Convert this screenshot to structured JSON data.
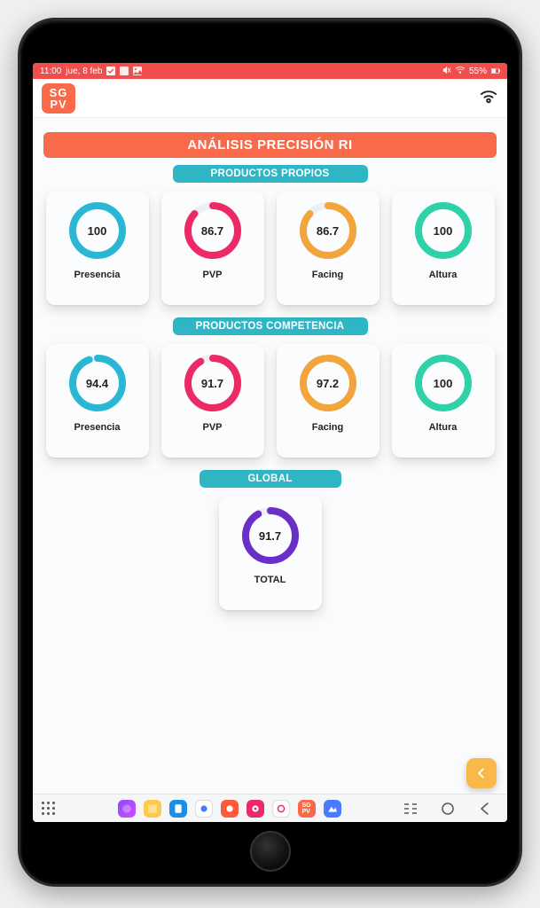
{
  "statusBar": {
    "time": "11:00",
    "date": "jue, 8 feb",
    "battery": "55%"
  },
  "header": {
    "logo_line1": "SG",
    "logo_line2": "PV"
  },
  "title": "ANÁLISIS PRECISIÓN RI",
  "sections": {
    "propios": {
      "label": "PRODUCTOS PROPIOS",
      "cards": [
        {
          "value": "100",
          "pct": 100,
          "label": "Presencia",
          "color": "#29b7d3"
        },
        {
          "value": "86.7",
          "pct": 86.7,
          "label": "PVP",
          "color": "#ec2a66"
        },
        {
          "value": "86.7",
          "pct": 86.7,
          "label": "Facing",
          "color": "#f2a53c"
        },
        {
          "value": "100",
          "pct": 100,
          "label": "Altura",
          "color": "#2fd1a8"
        }
      ]
    },
    "competencia": {
      "label": "PRODUCTOS COMPETENCIA",
      "cards": [
        {
          "value": "94.4",
          "pct": 94.4,
          "label": "Presencia",
          "color": "#29b7d3"
        },
        {
          "value": "91.7",
          "pct": 91.7,
          "label": "PVP",
          "color": "#ec2a66"
        },
        {
          "value": "97.2",
          "pct": 97.2,
          "label": "Facing",
          "color": "#f2a53c"
        },
        {
          "value": "100",
          "pct": 100,
          "label": "Altura",
          "color": "#2fd1a8"
        }
      ]
    },
    "global": {
      "label": "GLOBAL",
      "cards": [
        {
          "value": "91.7",
          "pct": 91.7,
          "label": "TOTAL",
          "color": "#6a2fc7"
        }
      ]
    }
  },
  "chart_data": [
    {
      "type": "pie",
      "title": "Presencia (propios)",
      "values": [
        100
      ],
      "categories": [
        "%"
      ],
      "ylim": [
        0,
        100
      ]
    },
    {
      "type": "pie",
      "title": "PVP (propios)",
      "values": [
        86.7
      ],
      "categories": [
        "%"
      ],
      "ylim": [
        0,
        100
      ]
    },
    {
      "type": "pie",
      "title": "Facing (propios)",
      "values": [
        86.7
      ],
      "categories": [
        "%"
      ],
      "ylim": [
        0,
        100
      ]
    },
    {
      "type": "pie",
      "title": "Altura (propios)",
      "values": [
        100
      ],
      "categories": [
        "%"
      ],
      "ylim": [
        0,
        100
      ]
    },
    {
      "type": "pie",
      "title": "Presencia (competencia)",
      "values": [
        94.4
      ],
      "categories": [
        "%"
      ],
      "ylim": [
        0,
        100
      ]
    },
    {
      "type": "pie",
      "title": "PVP (competencia)",
      "values": [
        91.7
      ],
      "categories": [
        "%"
      ],
      "ylim": [
        0,
        100
      ]
    },
    {
      "type": "pie",
      "title": "Facing (competencia)",
      "values": [
        97.2
      ],
      "categories": [
        "%"
      ],
      "ylim": [
        0,
        100
      ]
    },
    {
      "type": "pie",
      "title": "Altura (competencia)",
      "values": [
        100
      ],
      "categories": [
        "%"
      ],
      "ylim": [
        0,
        100
      ]
    },
    {
      "type": "pie",
      "title": "TOTAL (global)",
      "values": [
        91.7
      ],
      "categories": [
        "%"
      ],
      "ylim": [
        0,
        100
      ]
    }
  ],
  "colors": {
    "accent_orange": "#f96a4a",
    "accent_teal": "#2fb6c4",
    "fab": "#f9b84a"
  }
}
